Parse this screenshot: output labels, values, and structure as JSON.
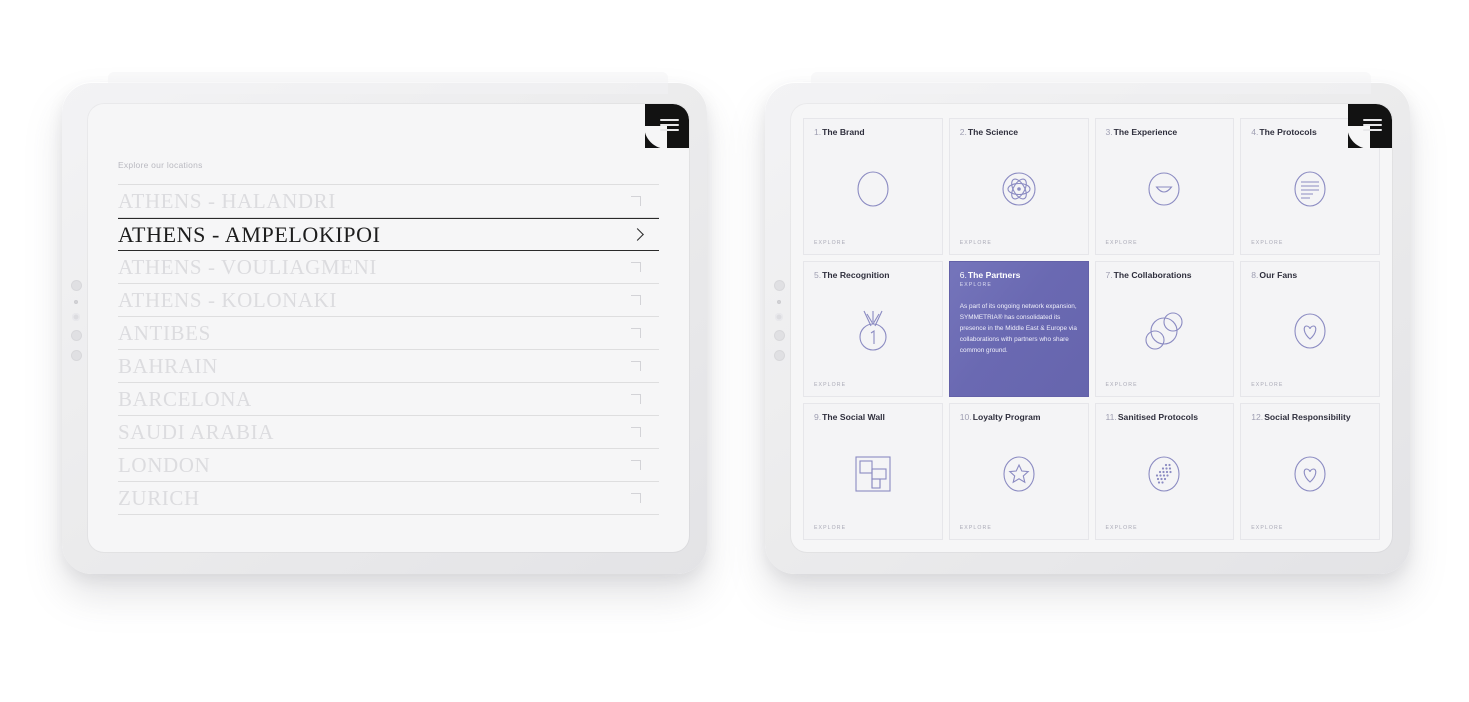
{
  "accent_purple": "#6a69b2",
  "icon_stroke": "#8b8bc2",
  "left_tablet": {
    "menu_icon": "hamburger-icon",
    "section_label": "Explore our locations",
    "locations": [
      {
        "name": "ATHENS - HALANDRI",
        "active": false,
        "marker": "corner-bracket"
      },
      {
        "name": "ATHENS - AMPELOKIPOI",
        "active": true,
        "marker": "chevron-right"
      },
      {
        "name": "ATHENS - VOULIAGMENI",
        "active": false,
        "marker": "corner-bracket"
      },
      {
        "name": "ATHENS - KOLONAKI",
        "active": false,
        "marker": "corner-bracket"
      },
      {
        "name": "ANTIBES",
        "active": false,
        "marker": "corner-bracket"
      },
      {
        "name": "BAHRAIN",
        "active": false,
        "marker": "corner-bracket"
      },
      {
        "name": "BARCELONA",
        "active": false,
        "marker": "corner-bracket"
      },
      {
        "name": "SAUDI ARABIA",
        "active": false,
        "marker": "corner-bracket"
      },
      {
        "name": "LONDON",
        "active": false,
        "marker": "corner-bracket"
      },
      {
        "name": "ZURICH",
        "active": false,
        "marker": "corner-bracket"
      }
    ]
  },
  "right_tablet": {
    "menu_icon": "hamburger-icon",
    "explore_label": "EXPLORE",
    "cards": [
      {
        "num": "1.",
        "title": "The Brand",
        "icon": "circle-icon",
        "explore": "EXPLORE",
        "active": false
      },
      {
        "num": "2.",
        "title": "The Science",
        "icon": "atom-icon",
        "explore": "EXPLORE",
        "active": false
      },
      {
        "num": "3.",
        "title": "The Experience",
        "icon": "smile-face-icon",
        "explore": "EXPLORE",
        "active": false
      },
      {
        "num": "4.",
        "title": "The Protocols",
        "icon": "document-lines-icon",
        "explore": "EXPLORE",
        "active": false
      },
      {
        "num": "5.",
        "title": "The Recognition",
        "icon": "medal-number-one-icon",
        "explore": "EXPLORE",
        "active": false
      },
      {
        "num": "6.",
        "title": "The Partners",
        "icon": "none",
        "explore": "EXPLORE",
        "active": true,
        "body": "As part of its ongoing network expansion, SYMMETRIA® has consolidated its presence in the Middle East & Europe via collaborations with partners who share common ground."
      },
      {
        "num": "7.",
        "title": "The Collaborations",
        "icon": "overlapping-circles-icon",
        "explore": "EXPLORE",
        "active": false
      },
      {
        "num": "8.",
        "title": "Our Fans",
        "icon": "heart-circle-icon",
        "explore": "EXPLORE",
        "active": false
      },
      {
        "num": "9.",
        "title": "The Social Wall",
        "icon": "grid-mosaic-icon",
        "explore": "EXPLORE",
        "active": false
      },
      {
        "num": "10.",
        "title": "Loyalty Program",
        "icon": "star-circle-icon",
        "explore": "EXPLORE",
        "active": false
      },
      {
        "num": "11.",
        "title": "Sanitised Protocols",
        "icon": "dots-spray-circle-icon",
        "explore": "EXPLORE",
        "active": false
      },
      {
        "num": "12.",
        "title": "Social Responsibility",
        "icon": "heart-circle-icon",
        "explore": "EXPLORE",
        "active": false
      }
    ]
  }
}
